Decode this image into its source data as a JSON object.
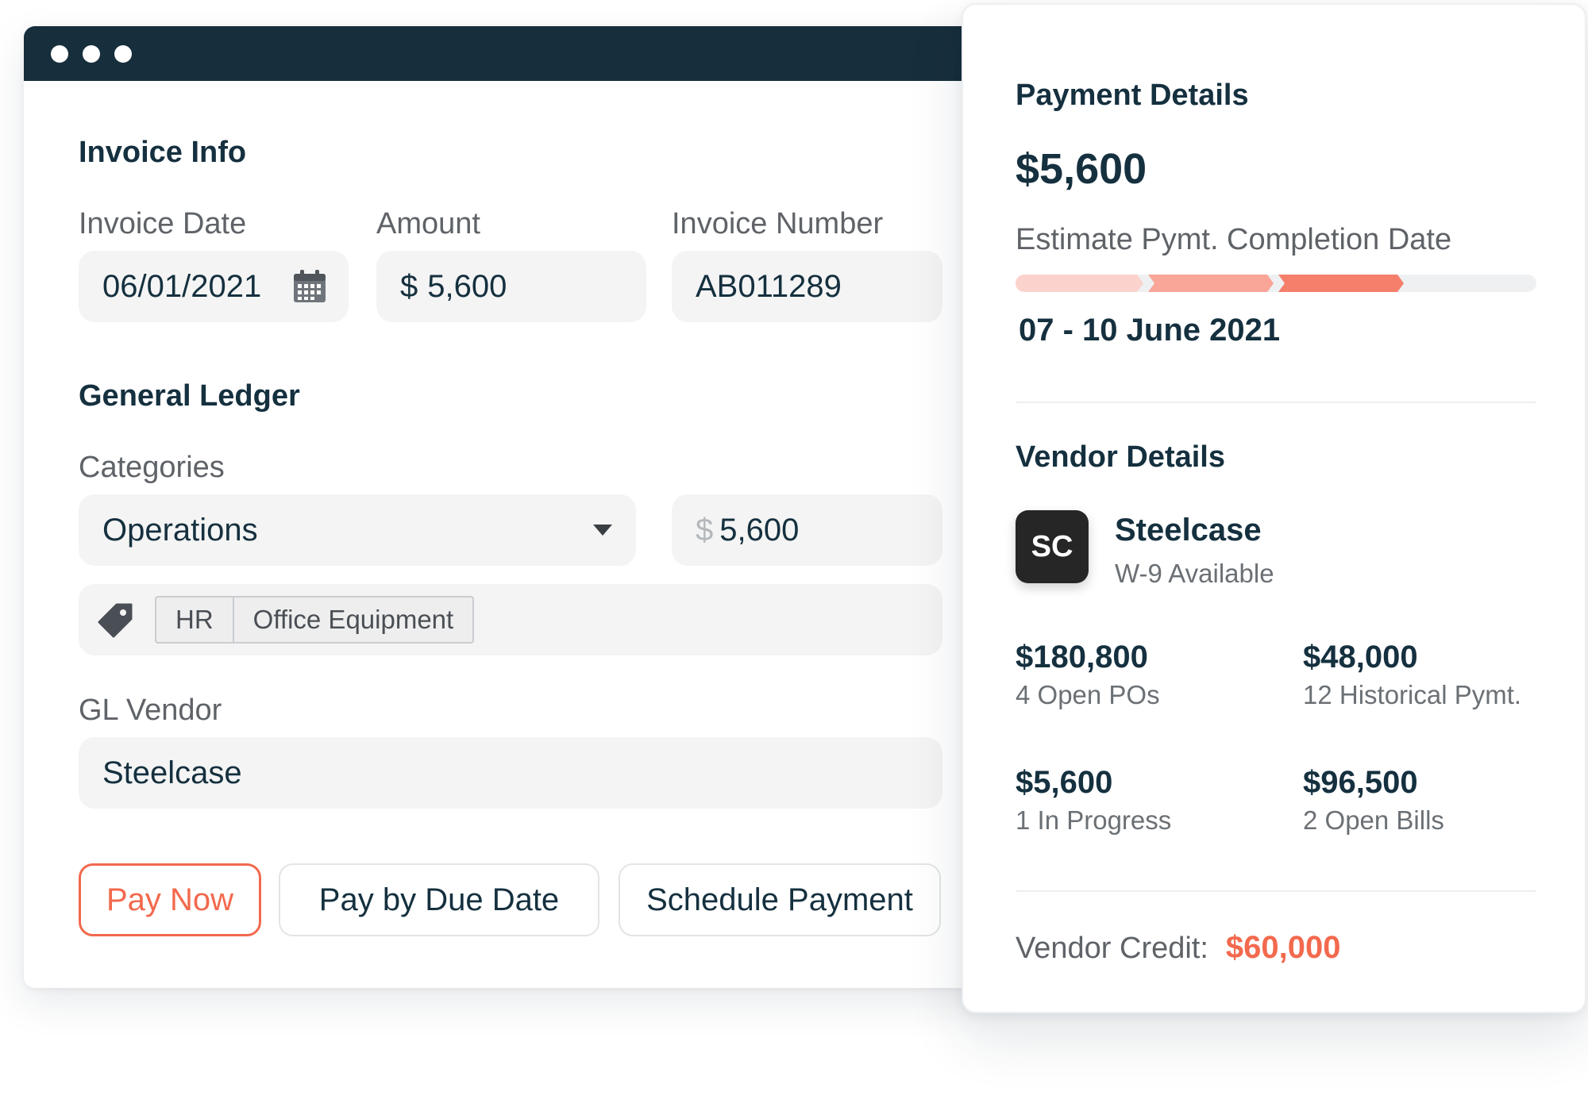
{
  "colors": {
    "titlebar": "#172e3c",
    "accent": "#f2694e",
    "field_bg": "#f4f4f4",
    "text_dark": "#15303f",
    "progress_segments": [
      "#fcd3cc",
      "#f9a597",
      "#f57f6b"
    ],
    "progress_track": "#eef0f2"
  },
  "invoice": {
    "section_title": "Invoice Info",
    "invoice_date": {
      "label": "Invoice Date",
      "value": "06/01/2021",
      "icon": "calendar-icon"
    },
    "amount": {
      "label": "Amount",
      "currency": "$",
      "value": "5,600"
    },
    "invoice_number": {
      "label": "Invoice Number",
      "value": "AB011289"
    }
  },
  "ledger": {
    "section_title": "General Ledger",
    "categories_label": "Categories",
    "category_value": "Operations",
    "category_amount_currency": "$",
    "category_amount": "5,600",
    "tag_icon": "tag-icon",
    "tags": [
      "HR",
      "Office Equipment"
    ],
    "gl_vendor_label": "GL Vendor",
    "gl_vendor_value": "Steelcase"
  },
  "actions": {
    "pay_now": "Pay Now",
    "pay_by_due_date": "Pay by Due Date",
    "schedule_payment": "Schedule Payment"
  },
  "payment": {
    "title": "Payment Details",
    "amount": "$5,600",
    "estimate_label": "Estimate Pymt. Completion Date",
    "progress_steps_total": 4,
    "progress_steps_complete": 3,
    "estimate_date": "07 - 10 June 2021"
  },
  "vendor": {
    "title": "Vendor Details",
    "initials": "SC",
    "name": "Steelcase",
    "w9": "W-9 Available",
    "stats": [
      {
        "value": "$180,800",
        "label": "4 Open POs"
      },
      {
        "value": "$48,000",
        "label": "12 Historical Pymt."
      },
      {
        "value": "$5,600",
        "label": "1 In Progress"
      },
      {
        "value": "$96,500",
        "label": "2 Open Bills"
      }
    ],
    "credit_label": "Vendor Credit:",
    "credit_value": "$60,000"
  }
}
